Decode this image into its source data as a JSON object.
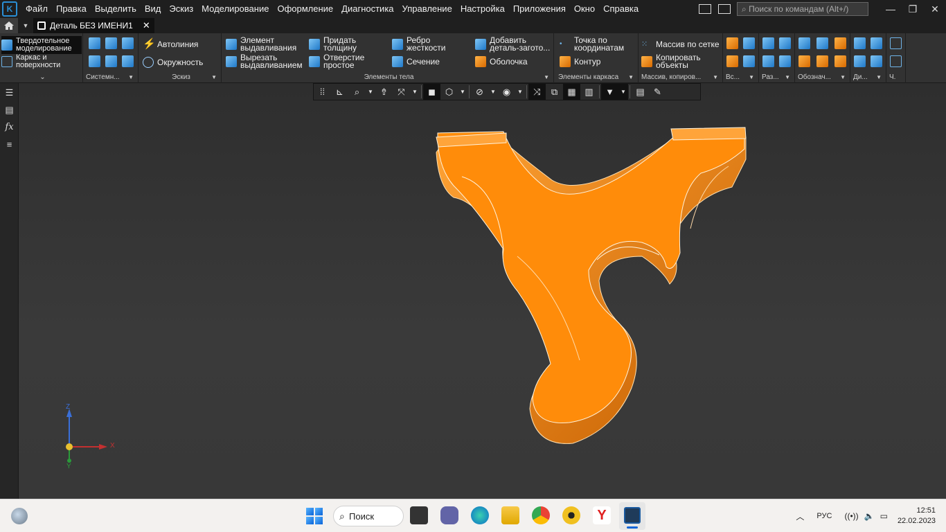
{
  "menu": [
    "Файл",
    "Правка",
    "Выделить",
    "Вид",
    "Эскиз",
    "Моделирование",
    "Оформление",
    "Диагностика",
    "Управление",
    "Настройка",
    "Приложения",
    "Окно",
    "Справка"
  ],
  "search": {
    "placeholder": "Поиск по командам (Alt+/)"
  },
  "tab": {
    "title": "Деталь БЕЗ ИМЕНИ1"
  },
  "ribbon": {
    "modes": {
      "solid": "Твердотельное моделирование",
      "wire": "Каркас и поверхности"
    },
    "groups": {
      "system": "Системн...",
      "sketch": "Эскиз",
      "body": "Элементы тела",
      "frame": "Элементы каркаса",
      "array": "Массив, копиров...",
      "aux": "Вс...",
      "cuts": "Раз...",
      "designations": "Обознач...",
      "di": "Ди...",
      "ch": "Ч."
    },
    "sketch": {
      "autoline": "Автолиния",
      "circle": "Окружность"
    },
    "body": {
      "extrude": "Элемент выдавливания",
      "cut_extrude": "Вырезать выдавливанием",
      "thickness": "Придать толщину",
      "hole": "Отверстие простое",
      "rib": "Ребро жесткости",
      "section": "Сечение",
      "add_blank": "Добавить деталь-загото...",
      "shell": "Оболочка"
    },
    "frame": {
      "point": "Точка по координатам",
      "contour": "Контур"
    },
    "array": {
      "grid": "Массив по сетке",
      "copy": "Копировать объекты"
    }
  },
  "axes": {
    "x": "X",
    "y": "Y",
    "z": "Z"
  },
  "taskbar": {
    "search": "Поиск",
    "lang": "РУС",
    "time": "12:51",
    "date": "22.02.2023"
  },
  "colors": {
    "part": "#ff8c0a",
    "accent": "#2a8fd6"
  }
}
